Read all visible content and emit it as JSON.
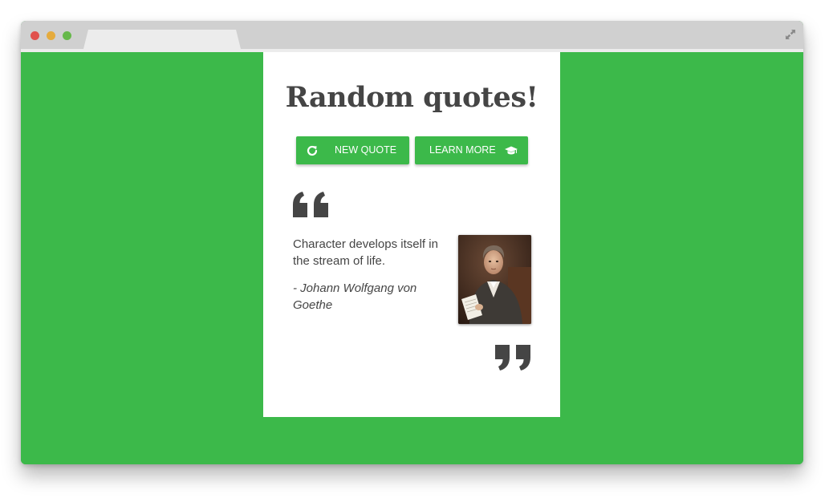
{
  "browser": {
    "window_buttons": [
      "close",
      "minimize",
      "maximize"
    ],
    "tab_title": "",
    "expand_icon": "expand-arrows-icon"
  },
  "colors": {
    "background_green": "#3cb94a",
    "button_green": "#3cb94a",
    "text_dark": "#454545",
    "card": "#ffffff"
  },
  "page": {
    "title": "Random quotes!",
    "buttons": {
      "new_quote": {
        "label": "NEW QUOTE",
        "icon": "refresh-icon"
      },
      "learn_more": {
        "label": "LEARN MORE",
        "icon": "graduation-cap-icon"
      }
    },
    "quote": {
      "open_mark_icon": "open-quote-icon",
      "close_mark_icon": "close-quote-icon",
      "text": "Character develops itself in the stream of life.",
      "author": "- Johann Wolfgang von Goethe",
      "portrait": "author-portrait"
    }
  }
}
